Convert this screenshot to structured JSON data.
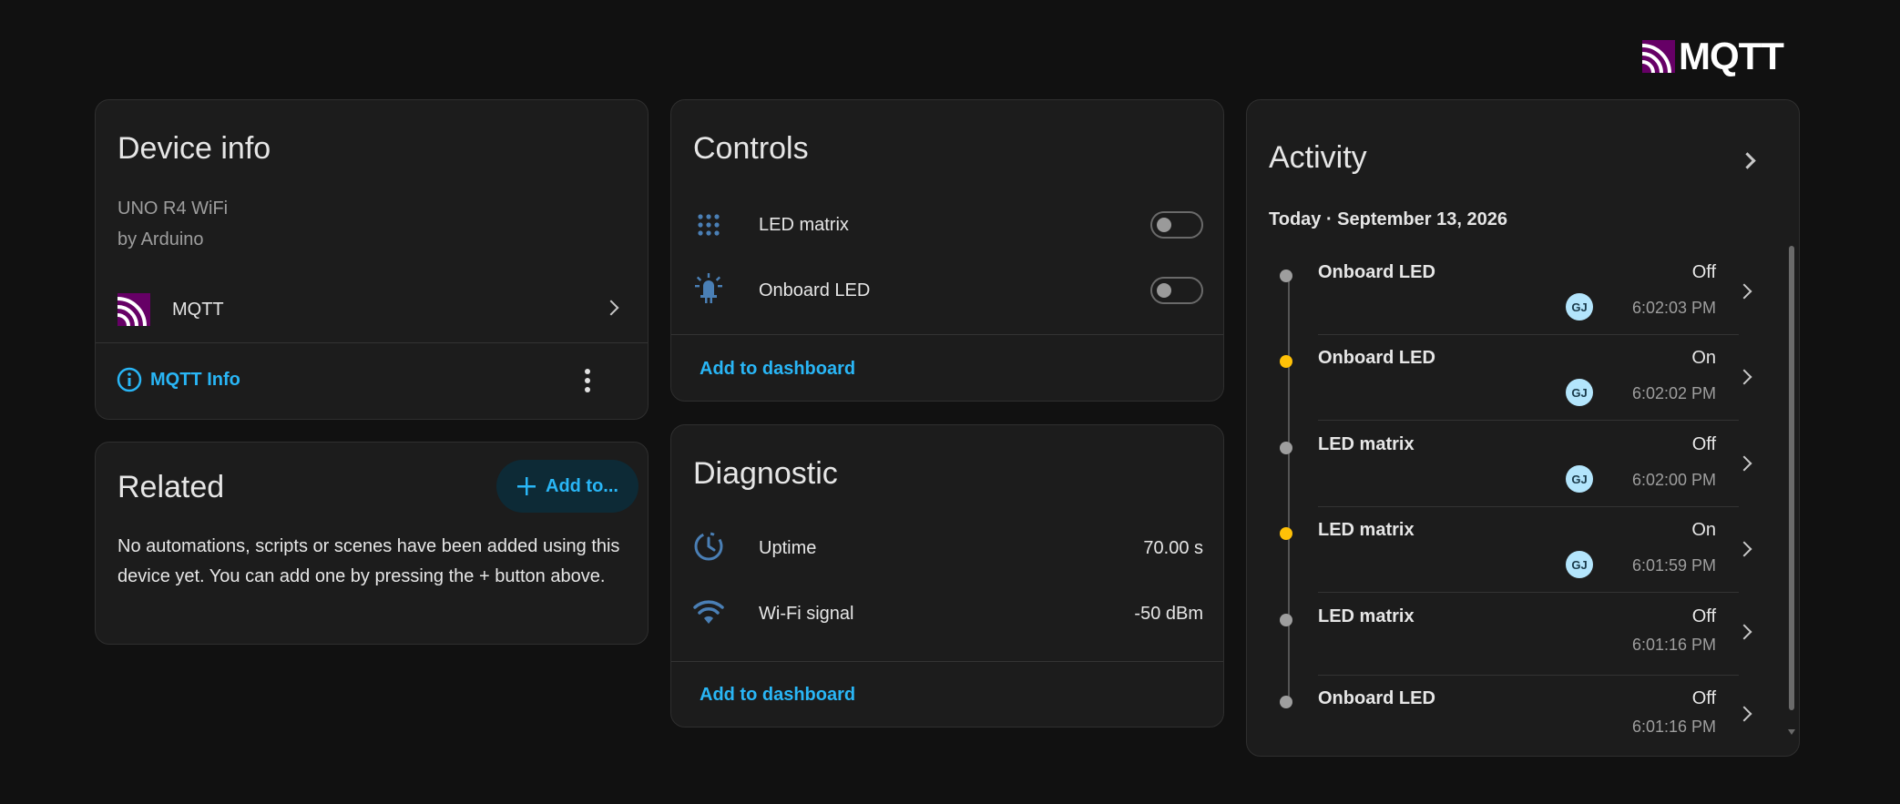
{
  "brand": {
    "logo_text": "MQTT"
  },
  "device_info": {
    "title": "Device info",
    "model": "UNO R4 WiFi",
    "manufacturer": "by Arduino",
    "integration_name": "MQTT",
    "info_link": "MQTT Info"
  },
  "related": {
    "title": "Related",
    "add_button": "Add to...",
    "message": "No automations, scripts or scenes have been added using this device yet. You can add one by pressing the + button above."
  },
  "controls": {
    "title": "Controls",
    "items": [
      {
        "label": "LED matrix",
        "icon": "dot-grid-icon",
        "state": "off"
      },
      {
        "label": "Onboard LED",
        "icon": "led-icon",
        "state": "off"
      }
    ],
    "add_link": "Add to dashboard"
  },
  "diagnostic": {
    "title": "Diagnostic",
    "items": [
      {
        "label": "Uptime",
        "value": "70.00 s",
        "icon": "clock-icon"
      },
      {
        "label": "Wi-Fi signal",
        "value": "-50 dBm",
        "icon": "wifi-icon"
      }
    ],
    "add_link": "Add to dashboard"
  },
  "activity": {
    "title": "Activity",
    "date_header": "Today · September 13, 2026",
    "entries": [
      {
        "name": "Onboard LED",
        "state": "Off",
        "time": "6:02:03 PM",
        "user": "GJ",
        "dot_color": "#9e9e9e"
      },
      {
        "name": "Onboard LED",
        "state": "On",
        "time": "6:02:02 PM",
        "user": "GJ",
        "dot_color": "#ffc107"
      },
      {
        "name": "LED matrix",
        "state": "Off",
        "time": "6:02:00 PM",
        "user": "GJ",
        "dot_color": "#9e9e9e"
      },
      {
        "name": "LED matrix",
        "state": "On",
        "time": "6:01:59 PM",
        "user": "GJ",
        "dot_color": "#ffc107"
      },
      {
        "name": "LED matrix",
        "state": "Off",
        "time": "6:01:16 PM",
        "user": "",
        "dot_color": "#9e9e9e"
      },
      {
        "name": "Onboard LED",
        "state": "Off",
        "time": "6:01:16 PM",
        "user": "",
        "dot_color": "#9e9e9e"
      }
    ]
  },
  "colors": {
    "accent": "#29b6f6",
    "mqtt_purple": "#660066",
    "on_dot": "#ffc107",
    "off_dot": "#9e9e9e",
    "icon_blue": "#4a7fb5"
  }
}
